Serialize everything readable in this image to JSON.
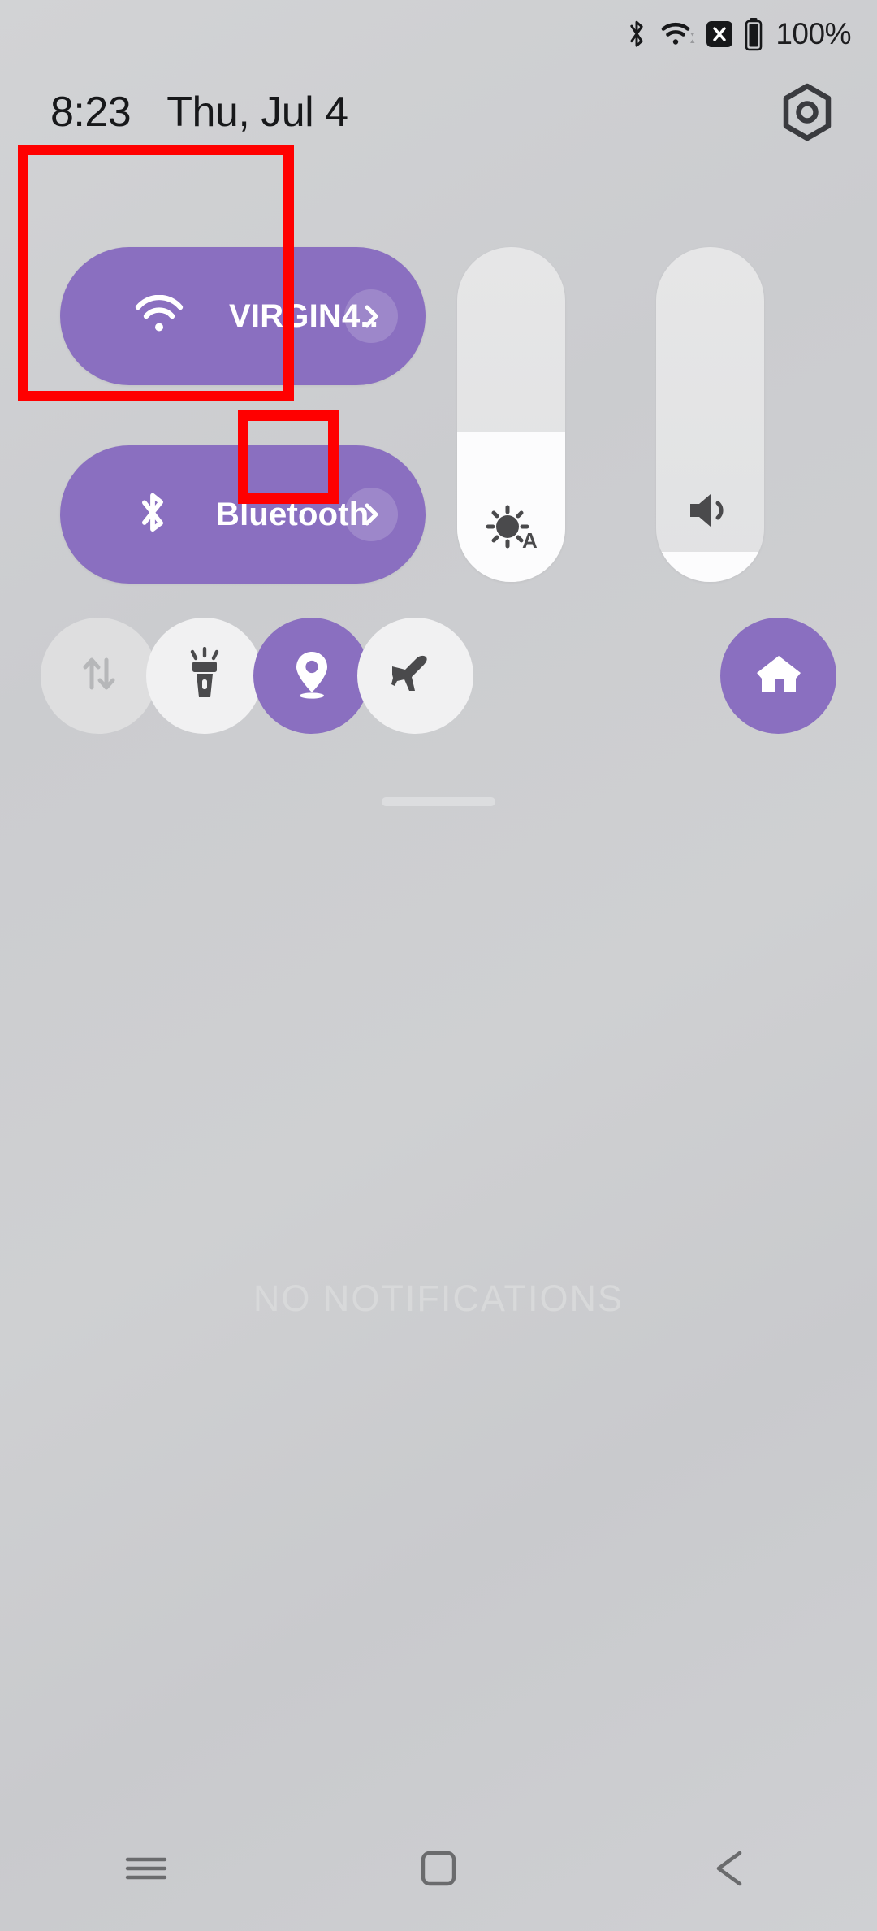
{
  "statusbar": {
    "icons": [
      "bluetooth-icon",
      "wifi-icon",
      "sim-x-icon",
      "battery-icon"
    ],
    "battery_text": "100%"
  },
  "header": {
    "time": "8:23",
    "date": "Thu, Jul 4",
    "settings_icon": "gear-icon"
  },
  "tiles": {
    "wifi": {
      "label": "VIRGIN4..",
      "icon": "wifi-icon",
      "chevron": "chevron-right-icon",
      "state": "on",
      "color": "#8a6fc0"
    },
    "bluetooth": {
      "label": "Bluetooth",
      "icon": "bluetooth-icon",
      "chevron": "chevron-right-icon",
      "state": "on",
      "color": "#8a6fc0"
    },
    "brightness": {
      "name": "brightness-slider",
      "icon": "brightness-auto-icon",
      "value_percent": 45,
      "auto": "A"
    },
    "volume": {
      "name": "volume-slider",
      "icon": "volume-icon",
      "value_percent": 9
    }
  },
  "toggles": [
    {
      "name": "mobile-data-toggle",
      "icon": "data-transfer-icon",
      "state": "disabled"
    },
    {
      "name": "flashlight-toggle",
      "icon": "flashlight-icon",
      "state": "off"
    },
    {
      "name": "location-toggle",
      "icon": "location-pin-icon",
      "state": "on"
    },
    {
      "name": "airplane-mode-toggle",
      "icon": "airplane-icon",
      "state": "off"
    },
    {
      "name": "smart-home-toggle",
      "icon": "home-icon",
      "state": "on"
    }
  ],
  "notifications": {
    "empty_text": "NO NOTIFICATIONS"
  },
  "navbar": {
    "items": [
      {
        "name": "nav-recents-button",
        "icon": "menu-icon"
      },
      {
        "name": "nav-home-button",
        "icon": "square-icon"
      },
      {
        "name": "nav-back-button",
        "icon": "triangle-left-icon"
      }
    ]
  },
  "annotations": {
    "boxes": [
      {
        "name": "annotation-box-connectivity-tiles",
        "color": "#ff0000"
      },
      {
        "name": "annotation-box-location-toggle",
        "color": "#ff0000"
      }
    ]
  },
  "colors": {
    "accent_purple": "#8a6fc0",
    "annotation_red": "#ff0000",
    "background": "#cfd0d2"
  }
}
